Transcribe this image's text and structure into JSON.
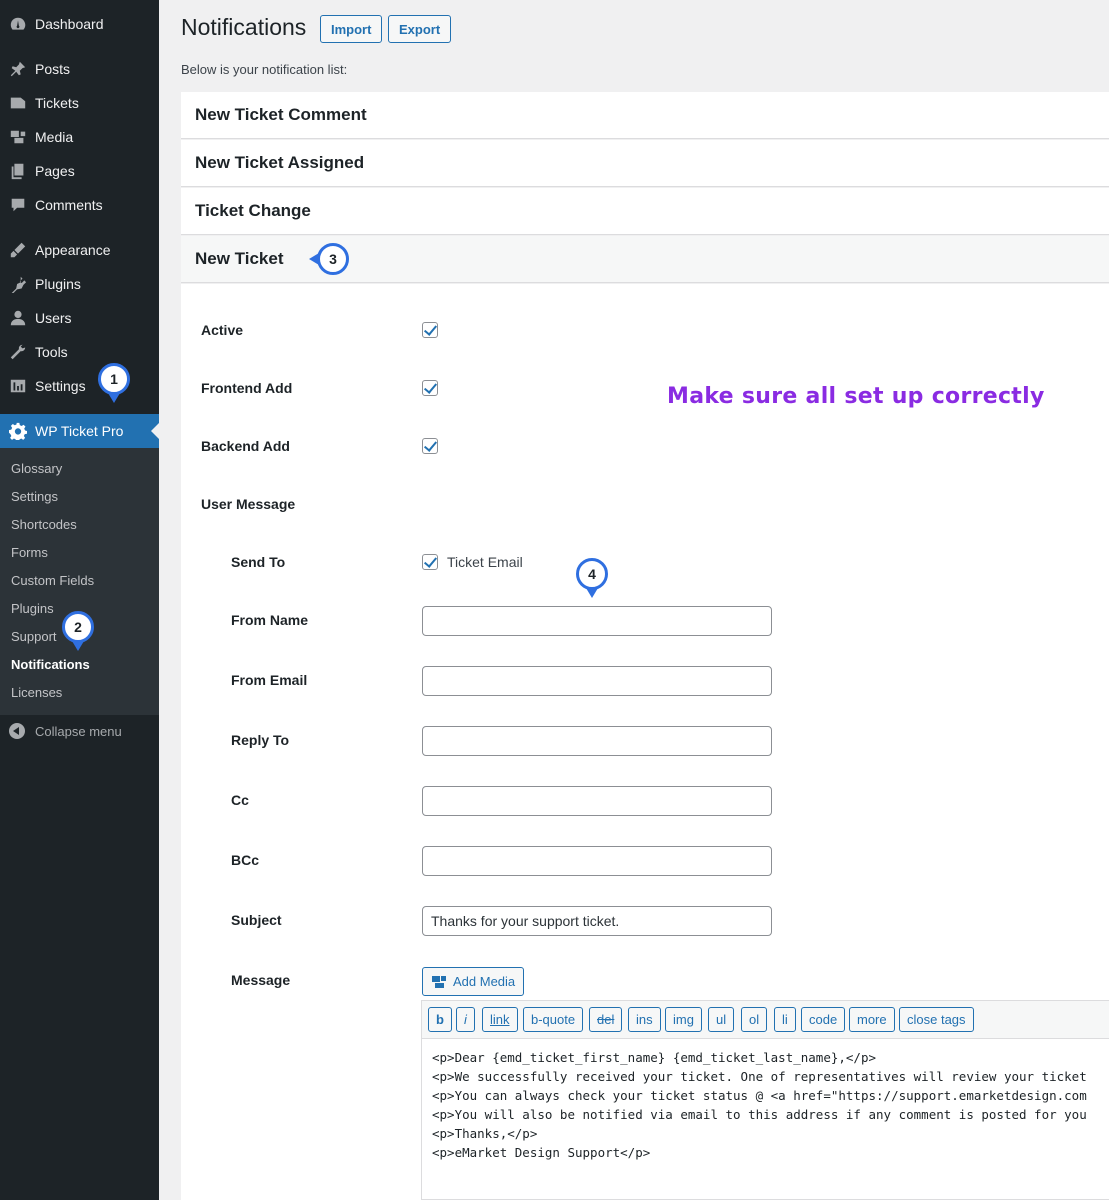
{
  "sidebar": {
    "items": [
      {
        "label": "Dashboard",
        "icon": "dashboard-icon"
      },
      {
        "label": "Posts",
        "icon": "pin-icon"
      },
      {
        "label": "Tickets",
        "icon": "tickets-icon"
      },
      {
        "label": "Media",
        "icon": "media-icon"
      },
      {
        "label": "Pages",
        "icon": "pages-icon"
      },
      {
        "label": "Comments",
        "icon": "comments-icon"
      },
      {
        "label": "Appearance",
        "icon": "brush-icon"
      },
      {
        "label": "Plugins",
        "icon": "plugin-icon"
      },
      {
        "label": "Users",
        "icon": "user-icon"
      },
      {
        "label": "Tools",
        "icon": "wrench-icon"
      },
      {
        "label": "Settings",
        "icon": "settings-icon"
      },
      {
        "label": "WP Ticket Pro",
        "icon": "gear-icon"
      }
    ],
    "submenu": [
      "Glossary",
      "Settings",
      "Shortcodes",
      "Forms",
      "Custom Fields",
      "Plugins",
      "Support",
      "Notifications",
      "Licenses"
    ],
    "collapse_label": "Collapse menu"
  },
  "callouts": [
    "1",
    "2",
    "3",
    "4"
  ],
  "header": {
    "title": "Notifications",
    "import_label": "Import",
    "export_label": "Export",
    "intro": "Below is your notification list:"
  },
  "accordion": [
    "New Ticket Comment",
    "New Ticket Assigned",
    "Ticket Change",
    "New Ticket"
  ],
  "form": {
    "active_label": "Active",
    "frontend_label": "Frontend Add",
    "backend_label": "Backend Add",
    "user_message_label": "User Message",
    "send_to_label": "Send To",
    "ticket_email_label": "Ticket Email",
    "from_name_label": "From Name",
    "from_email_label": "From Email",
    "reply_to_label": "Reply To",
    "cc_label": "Cc",
    "bcc_label": "BCc",
    "subject_label": "Subject",
    "subject_value": "Thanks for your support ticket.",
    "message_label": "Message",
    "add_media_label": "Add Media"
  },
  "annotation": "Make sure all set up correctly",
  "toolbar": [
    "b",
    "i",
    "link",
    "b-quote",
    "del",
    "ins",
    "img",
    "ul",
    "ol",
    "li",
    "code",
    "more",
    "close tags"
  ],
  "message_lines": [
    "<p>Dear {emd_ticket_first_name} {emd_ticket_last_name},</p>",
    "<p>We successfully received your ticket. One of representatives will review your ticket",
    "<p>You can always check your ticket status @ <a href=\"https://support.emarketdesign.com",
    "<p>You will also be notified via email to this address if any comment is posted for you",
    "<p>Thanks,</p>",
    "<p>eMarket Design Support</p>"
  ],
  "colors": {
    "accent": "#2271b1",
    "sidebar": "#1d2327",
    "submenu": "#2c3338",
    "callout": "#2f6fe0",
    "annotation": "#8a2be2"
  }
}
